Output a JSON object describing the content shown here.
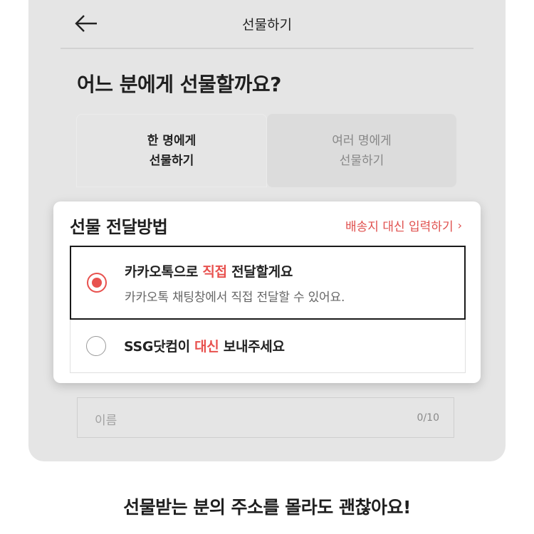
{
  "header": {
    "title": "선물하기"
  },
  "question": "어느 분에게 선물할까요?",
  "tabs": {
    "single": {
      "line1": "한 명에게",
      "line2": "선물하기"
    },
    "multi": {
      "line1": "여러 명에게",
      "line2": "선물하기"
    }
  },
  "delivery": {
    "title": "선물 전달방법",
    "link_label": "배송지 대신 입력하기",
    "options": [
      {
        "pre": "카카오톡으로 ",
        "highlight": "직접",
        "post": " 전달할게요",
        "sub": "카카오톡 채팅창에서 직접 전달할 수 있어요.",
        "selected": true
      },
      {
        "pre": "SSG닷컴이 ",
        "highlight": "대신",
        "post": " 보내주세요",
        "selected": false
      }
    ]
  },
  "name_input": {
    "placeholder": "이름",
    "counter": "0/10"
  },
  "caption": "선물받는 분의 주소를 몰라도 괜찮아요!",
  "colors": {
    "accent": "#e8514e",
    "background": "#e5e5e5"
  },
  "icons": {
    "back": "arrow-left-icon",
    "link": "chevron-right-icon"
  }
}
